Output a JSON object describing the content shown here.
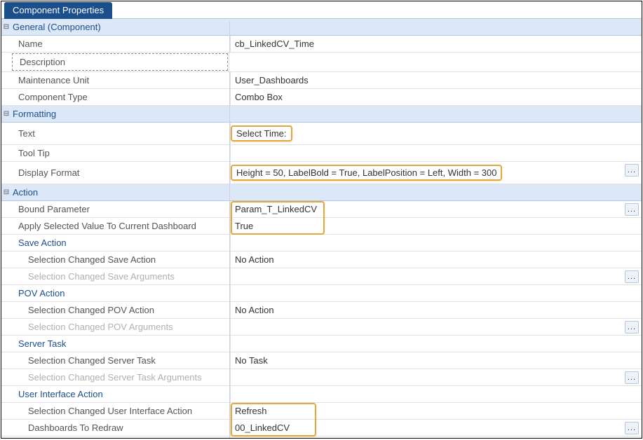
{
  "tab": {
    "title": "Component Properties"
  },
  "sections": {
    "general": {
      "title": "General (Component)",
      "name_label": "Name",
      "name_value": "cb_LinkedCV_Time",
      "desc_label": "Description",
      "desc_value": "",
      "maint_label": "Maintenance Unit",
      "maint_value": "User_Dashboards",
      "ctype_label": "Component Type",
      "ctype_value": "Combo Box"
    },
    "formatting": {
      "title": "Formatting",
      "text_label": "Text",
      "text_value": "Select Time:",
      "tooltip_label": "Tool Tip",
      "tooltip_value": "",
      "dispfmt_label": "Display Format",
      "dispfmt_value": "Height = 50, LabelBold = True, LabelPosition = Left, Width = 300"
    },
    "action": {
      "title": "Action",
      "bound_label": "Bound Parameter",
      "bound_value": "Param_T_LinkedCV",
      "apply_label": "Apply Selected Value To Current Dashboard",
      "apply_value": "True",
      "save_action": {
        "title": "Save Action",
        "sel_label": "Selection Changed Save Action",
        "sel_value": "No Action",
        "arg_label": "Selection Changed Save Arguments",
        "arg_value": ""
      },
      "pov_action": {
        "title": "POV Action",
        "sel_label": "Selection Changed POV Action",
        "sel_value": "No Action",
        "arg_label": "Selection Changed POV Arguments",
        "arg_value": ""
      },
      "server_task": {
        "title": "Server Task",
        "sel_label": "Selection Changed Server Task",
        "sel_value": "No Task",
        "arg_label": "Selection Changed Server Task Arguments",
        "arg_value": ""
      },
      "ui_action": {
        "title": "User Interface Action",
        "sel_label": "Selection Changed User Interface Action",
        "sel_value": "Refresh",
        "dash_label": "Dashboards To Redraw",
        "dash_value": "00_LinkedCV"
      }
    }
  },
  "icons": {
    "ellipsis": "..."
  }
}
